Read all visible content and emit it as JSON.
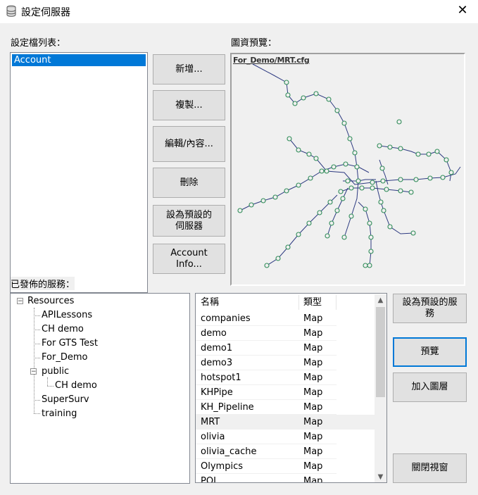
{
  "window": {
    "title": "設定伺服器",
    "close_label": "✕"
  },
  "profiles": {
    "label": "設定檔列表：",
    "items": [
      "Account"
    ]
  },
  "buttons": {
    "add": "新增...",
    "copy": "複製...",
    "edit": "編輯/內容...",
    "delete": "刪除",
    "set_default_server_1": "設為預設的",
    "set_default_server_2": "伺服器",
    "account_info_1": "Account",
    "account_info_2": "Info...",
    "set_default_service_1": "設為預設的服",
    "set_default_service_2": "務",
    "preview": "預覽",
    "add_layer": "加入圖層",
    "close_window": "關閉視窗"
  },
  "preview": {
    "label": "圖資預覽：",
    "map_title": "For_Demo/MRT.cfg"
  },
  "services": {
    "label": "已發佈的服務：",
    "tree": {
      "root": "Resources",
      "children": [
        "APILessons",
        "CH demo",
        "For GTS Test",
        "For_Demo",
        "public",
        "CH demo",
        "SuperSurv",
        "training"
      ]
    },
    "table": {
      "col_name": "名稱",
      "col_type": "類型",
      "rows": [
        {
          "name": "companies",
          "type": "Map"
        },
        {
          "name": "demo",
          "type": "Map"
        },
        {
          "name": "demo1",
          "type": "Map"
        },
        {
          "name": "demo3",
          "type": "Map"
        },
        {
          "name": "hotspot1",
          "type": "Map"
        },
        {
          "name": "KHPipe",
          "type": "Map"
        },
        {
          "name": "KH_Pipeline",
          "type": "Map"
        },
        {
          "name": "MRT",
          "type": "Map"
        },
        {
          "name": "olivia",
          "type": "Map"
        },
        {
          "name": "olivia_cache",
          "type": "Map"
        },
        {
          "name": "Olympics",
          "type": "Map"
        },
        {
          "name": "POI",
          "type": "Map"
        }
      ]
    }
  },
  "colors": {
    "selection": "#0078d7",
    "selected_row": "#f0f0f0",
    "map_line": "#2d3a80",
    "map_node": "#2e8b57"
  },
  "icons": {
    "app": "database-icon",
    "close": "close-icon",
    "scroll_up": "scroll-up-icon",
    "scroll_down": "scroll-down-icon"
  }
}
